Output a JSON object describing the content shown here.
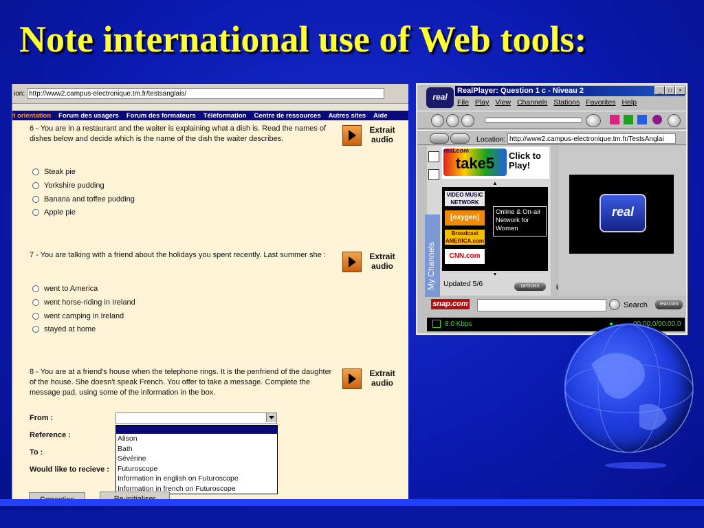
{
  "slide": {
    "title": "Note international use of Web tools:"
  },
  "browser": {
    "url_label": "ion:",
    "url": "http://www2.campus-electronique.tm.fr/testsanglais/",
    "nav": [
      "et orientation",
      "Forum des usagers",
      "Forum des formateurs",
      "Téléformation",
      "Centre de ressources",
      "Autres sites",
      "Aide"
    ],
    "audio_label_1": "Extrait",
    "audio_label_2": "audio",
    "q6": {
      "text": "6 - You are in a restaurant and the waiter is explaining what a dish is. Read the names of dishes below and decide which is the name of the dish the waiter describes.",
      "options": [
        "Steak pie",
        "Yorkshire pudding",
        "Banana and toffee pudding",
        "Apple pie"
      ]
    },
    "q7": {
      "text": "7 - You are talking with a friend about the holidays you spent recently. Last summer she :",
      "options": [
        "went to America",
        "went horse-riding in Ireland",
        "went camping in Ireland",
        "stayed at home"
      ]
    },
    "q8": {
      "text": "8 - You are at a friend's house when the telephone rings. It is the penfriend of the daughter of the house. She doesn't speak French. You offer to take a message. Complete the message pad, using some of the information in the box."
    },
    "form": {
      "from": "From :",
      "reference": "Reference :",
      "to": "To :",
      "would_like": "Would like to recieve :",
      "dropdown_options": [
        "Alison",
        "Bath",
        "Sévérine",
        "Futuroscope",
        "Information in english on Futuroscope",
        "Information in french on Futuroscope"
      ]
    },
    "buttons": {
      "correction": "Correction",
      "reinit": "Re-initialiser"
    }
  },
  "realplayer": {
    "logo": "real",
    "title": "RealPlayer: Question 1 c - Niveau 2",
    "menu": [
      "File",
      "Play",
      "View",
      "Channels",
      "Stations",
      "Favorites",
      "Help"
    ],
    "location_label": "Location:",
    "location_url": "http://www2.campus-electronique.tm.fr/TestsAnglai",
    "take5": {
      "small": "real.com",
      "logo": "take5",
      "cta": "Click to Play!"
    },
    "channels": [
      "VIDEO MUSIC NETWORK",
      "[oxygen]",
      "Broadcast AMERICA.com",
      "CNN.com"
    ],
    "tooltip": "Online & On-air Network for Women",
    "my_channels": "My Channels",
    "updated": "Updated 5/6",
    "options_btn": "OPTIONS",
    "snap": "snap.com",
    "search": "Search",
    "realcom_btn": "real.com",
    "status_rate": "8.0 Kbps",
    "status_time": "00:00.0/00:00.0",
    "video_logo": "real"
  }
}
